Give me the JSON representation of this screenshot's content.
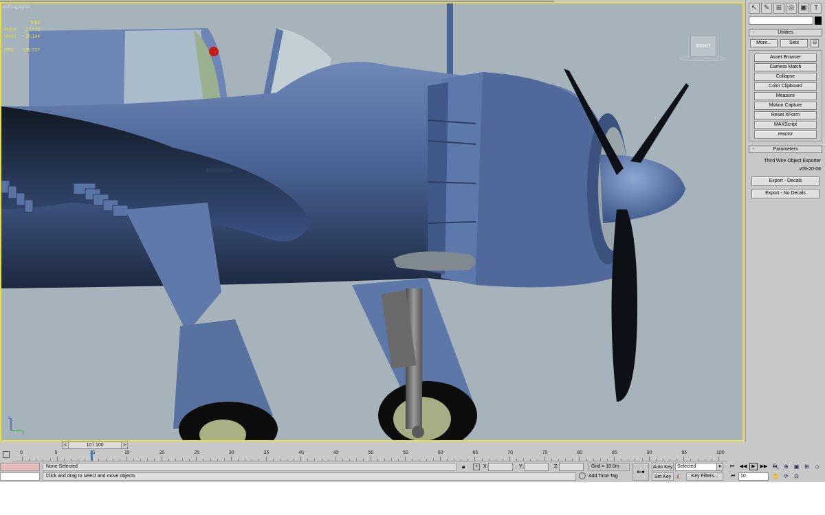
{
  "viewport": {
    "label": "Orthographic",
    "viewcube_face": "RIGHT",
    "stats": [
      {
        "label": "",
        "value": "Total"
      },
      {
        "label": "Polys:",
        "value": "27,773"
      },
      {
        "label": "Verts:",
        "value": "30,144"
      },
      {
        "label": "FPS:",
        "value": "120.727"
      }
    ]
  },
  "command_panel": {
    "tab_icons": [
      "select-arrow-icon",
      "modify-icon",
      "hierarchy-icon",
      "motion-icon",
      "display-icon",
      "utilities-hammer-icon"
    ],
    "utilities": {
      "title": "Utilities",
      "more": "More...",
      "sets": "Sets",
      "buttons": [
        "Asset Browser",
        "Camera Match",
        "Collapse",
        "Color Clipboard",
        "Measure",
        "Motion Capture",
        "Reset XForm",
        "MAXScript",
        "reactor"
      ]
    },
    "parameters": {
      "title": "Parameters",
      "plugin_name": "Third Wire Object Exporter",
      "version": "v09-20-08",
      "export_decals": "Export - Decals",
      "export_no_decals": "Export - No Decals"
    },
    "rollout_sign": "-"
  },
  "timeline": {
    "frame_display": "10 / 100",
    "prev": "<",
    "next": ">",
    "ticks": [
      "0",
      "5",
      "10",
      "15",
      "20",
      "25",
      "30",
      "35",
      "40",
      "45",
      "50",
      "55",
      "60",
      "65",
      "70",
      "75",
      "80",
      "85",
      "90",
      "95",
      "100"
    ]
  },
  "status": {
    "selection": "None Selected",
    "prompt": "Click and drag to select and move objects",
    "x_label": "X:",
    "y_label": "Y:",
    "z_label": "Z:",
    "grid": "Grid = 10.0m",
    "add_time_tag": "Add Time Tag",
    "auto_key": "Auto Key",
    "set_key": "Set Key",
    "key_mode": "Selected",
    "key_filters": "Key Filters...",
    "current_frame": "10"
  },
  "colors": {
    "viewport_bg": "#a6b3ba",
    "active_border": "#e8e040",
    "aircraft_blue": "#4f6a9c",
    "stats_text": "#e6e040"
  }
}
